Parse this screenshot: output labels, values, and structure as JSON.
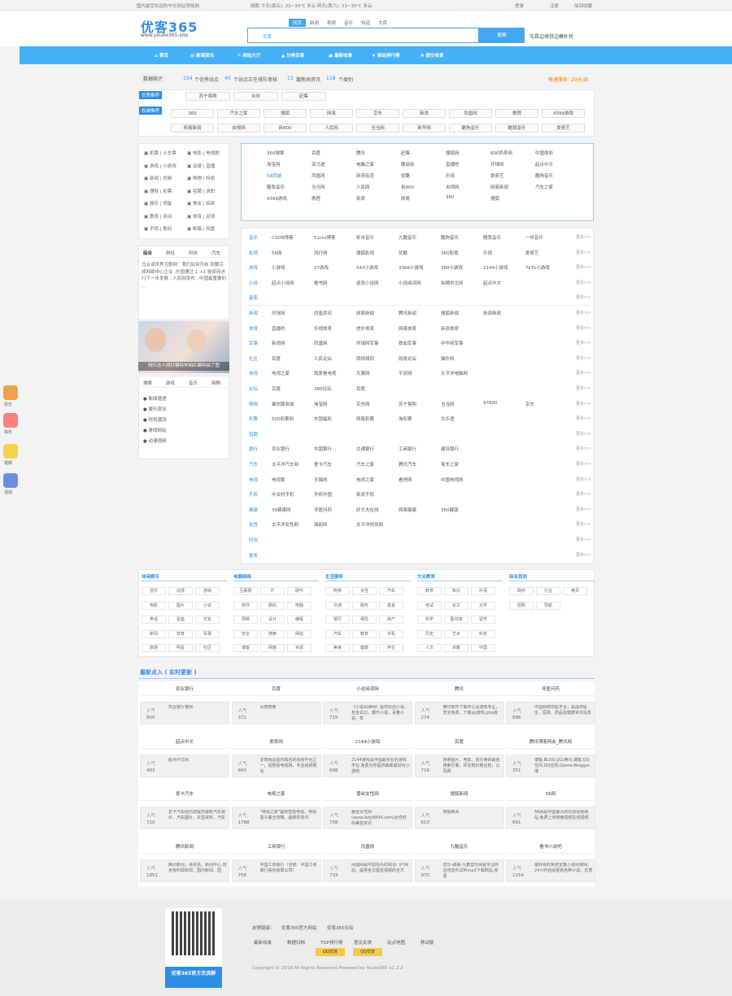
{
  "topbar": {
    "left": "国内最受欢迎的中文网站导航网",
    "weather": "晴朗 今天(周五): 23~30℃ 多云 明天(周六): 23~30℃ 多云",
    "login": "登录",
    "register": "注册",
    "favorite": "加到收藏"
  },
  "header": {
    "logo": "优客365",
    "url": "www.youke365.site",
    "tabs": [
      "网页",
      "新闻",
      "视频",
      "音乐",
      "知道",
      "文库"
    ],
    "active_tab": "网页",
    "search_label": "百度",
    "search_btn": "搜索",
    "hot": "屯昌边境铁边模扑伏"
  },
  "nav": [
    "首页",
    "新闻资讯",
    "网站大厅",
    "分类目录",
    "最新收录",
    "网站排行榜",
    "提交收录"
  ],
  "stats": {
    "label": "数据统计",
    "sites": "154",
    "sites_txt": "个优秀站点",
    "pending": "40",
    "pending_txt": "个站点正在排队审核",
    "articles": "13",
    "articles_txt": "篇新闻资讯",
    "cats": "118",
    "cats_txt": "个类别",
    "promo": "快速服务: 20元/站"
  },
  "featured": {
    "label1": "优质推荐",
    "label2": "权威推荐",
    "row1": [
      "苏宁易购",
      "合欢",
      "赶集"
    ],
    "row2": [
      "360",
      "汽车之家",
      "搜狐",
      "网易",
      "京东",
      "新浪",
      "凤凰网",
      "携程",
      "4399游戏"
    ],
    "row3": [
      "网易新闻",
      "央视网",
      "拆800",
      "人民网",
      "当当网",
      "新华网",
      "酷狗音乐",
      "酷我音乐",
      "爱奇艺"
    ]
  },
  "left_cats": [
    [
      "机票",
      "火车票"
    ],
    [
      "电影",
      "电视剧"
    ],
    [
      "游戏",
      "小游戏"
    ],
    [
      "动漫",
      "直播"
    ],
    [
      "新闻",
      "视频"
    ],
    [
      "购物",
      "特卖"
    ],
    [
      "理财",
      "彩票"
    ],
    [
      "招聘",
      "求职"
    ],
    [
      "娱乐",
      "明星"
    ],
    [
      "美女",
      "搞笑"
    ],
    [
      "教育",
      "培训"
    ],
    [
      "体育",
      "足球"
    ],
    [
      "手机",
      "数码"
    ],
    [
      "邮箱",
      "网盘"
    ]
  ],
  "left_tabs": [
    "综合",
    "财经",
    "科技",
    "汽车"
  ],
  "left_news": "马云谈世界互联网：我们如何开启 就要完成网络中心企业 ,中国通过 1 +1 投资商进行下一步发展 , 人民网发布 , 中国最重要的 ...",
  "photo_caption": "网红达人网红模特学网红模特拍了图",
  "left_tabs2": [
    "搜索",
    "游戏",
    "音乐",
    "网购"
  ],
  "left_list": [
    "新闻速递",
    "娱乐资讯",
    "时尚潮流",
    "游戏网站",
    "动漫视频"
  ],
  "grid_links": [
    [
      "360搜索",
      "百度",
      "腾讯",
      "赶集",
      "搜狐网",
      "600奶茶网",
      "中国体彩"
    ],
    [
      "淘宝网",
      "亚马逊",
      "电脑之家",
      "蘑菇街",
      "直播吧",
      "环球网",
      "起点中文"
    ],
    [
      "58同城",
      "凤凰网",
      "新浪有道",
      "优酷",
      "乐视",
      "爱奇艺",
      "酷狗音乐"
    ],
    [
      "酷我音乐",
      "当当网",
      "人民网",
      "拆800",
      "央视网",
      "网易新闻",
      "汽车之家"
    ],
    [
      "4399游戏",
      "携程",
      "新浪",
      "网易",
      "360",
      "搜狐"
    ]
  ],
  "categories": [
    {
      "cat": "音乐",
      "links": [
        "CSDN博客",
        "51cto博客",
        "虾米音乐",
        "九酷音乐",
        "酷狗音乐",
        "酷我音乐",
        "一听音乐"
      ],
      "more": "更多>>"
    },
    {
      "cat": "影视",
      "links": [
        "56网",
        "风行网",
        "搜狐影视",
        "优酷",
        "360影视",
        "乐视",
        "爱奇艺"
      ],
      "more": "更多>>"
    },
    {
      "cat": "游戏",
      "links": [
        "小游戏",
        "37游戏",
        "543小游戏",
        "3366小游戏",
        "360小游戏",
        "2144小游戏",
        "7k7k小游戏"
      ],
      "more": "更多>>"
    },
    {
      "cat": "小说",
      "links": [
        "起点小说网",
        "看书网",
        "逐浪小说网",
        "小说阅读网",
        "纵横中文网",
        "起点中文"
      ],
      "more": "更多>>"
    },
    {
      "cat": "星座",
      "links": [],
      "more": "更多>>"
    },
    {
      "cat": "新闻",
      "links": [
        "环球网",
        "凤凰资讯",
        "网易新闻",
        "腾讯新闻",
        "搜狐新闻",
        "新浪新闻"
      ],
      "more": "更多>>"
    },
    {
      "cat": "体育",
      "links": [
        "直播吧",
        "乐视体育",
        "虎扑体育",
        "网易体育",
        "新浪体育"
      ],
      "more": "更多>>"
    },
    {
      "cat": "军事",
      "links": [
        "新浪网",
        "凤凰网",
        "环球网军事",
        "铁血军事",
        "中华网军事"
      ],
      "more": "更多>>"
    },
    {
      "cat": "社区",
      "links": [
        "百度",
        "人民论坛",
        "西祠胡同",
        "网易论坛",
        "猫扑网"
      ],
      "more": "更多>>"
    },
    {
      "cat": "电视",
      "links": [
        "电视之家",
        "我爱看电视",
        "天翼网",
        "平安网",
        "太平洋电脑网"
      ],
      "more": "更多>>"
    },
    {
      "cat": "论坛",
      "links": [
        "百度",
        "360论坛",
        "百度"
      ],
      "more": "更多>>"
    },
    {
      "cat": "购物",
      "links": [
        "聚划算商城",
        "淘宝网",
        "京东网",
        "苏宁易购",
        "当当网",
        "97800",
        "京东"
      ],
      "more": "更多>>"
    },
    {
      "cat": "彩票",
      "links": [
        "500彩票网",
        "中国福彩",
        "网易彩票",
        "淘彩票",
        "大乐透"
      ],
      "more": "更多>>"
    },
    {
      "cat": "招聘",
      "links": [],
      "more": "更多>>"
    },
    {
      "cat": "银行",
      "links": [
        "农业银行",
        "中国银行",
        "交通银行",
        "工商银行",
        "建设银行"
      ],
      "more": "更多>>"
    },
    {
      "cat": "汽车",
      "links": [
        "太平洋汽车网",
        "爱卡汽车",
        "汽车之家",
        "腾讯汽车",
        "易车之家"
      ],
      "more": "更多>>"
    },
    {
      "cat": "电视",
      "links": [
        "电视家",
        "天猫网",
        "电视之家",
        "看吧网",
        "中国电视网"
      ],
      "more": "更多>>"
    },
    {
      "cat": "手机",
      "links": [
        "中关村手机",
        "手机中国",
        "新浪手机"
      ],
      "more": "更多>>"
    },
    {
      "cat": "健康",
      "links": [
        "39健康网",
        "寻医问药",
        "好大夫在线",
        "网易健康",
        "360健康"
      ],
      "more": "更多>>"
    },
    {
      "cat": "女性",
      "links": [
        "太平洋女性网",
        "瑞丽网",
        "太平洋时尚网"
      ],
      "more": "更多>>"
    },
    {
      "cat": "时尚",
      "links": [],
      "more": "更多>>"
    },
    {
      "cat": "星座",
      "links": [],
      "more": "更多>>"
    }
  ],
  "dir_blocks": [
    {
      "title": "休闲娱乐",
      "tags": [
        "音乐",
        "动漫",
        "游戏",
        "电影",
        "图片",
        "小说",
        "笑话",
        "星座",
        "交友",
        "新闻",
        "体育",
        "军事",
        "旅游",
        "明星",
        "社区"
      ]
    },
    {
      "title": "电脑网络",
      "tags": [
        "互联网",
        "IT",
        "硬件",
        "软件",
        "数码",
        "电脑",
        "网络",
        "设计",
        "编程",
        "安全",
        "搜索",
        "网站",
        "博客",
        "网盘",
        "资源"
      ]
    },
    {
      "title": "生活服务",
      "tags": [
        "购物",
        "女性",
        "汽车",
        "交通",
        "服务",
        "基金",
        "银行",
        "保险",
        "房产",
        "汽车",
        "教育",
        "手机",
        "美食",
        "健康",
        "养生"
      ]
    },
    {
      "title": "文化教育",
      "tags": [
        "教育",
        "知识",
        "外语",
        "考试",
        "论文",
        "大学",
        "科学",
        "图书馆",
        "留学",
        "历史",
        "艺术",
        "科技",
        "人文",
        "宗教",
        "中国"
      ]
    },
    {
      "title": "综合其他",
      "tags": [
        "政府",
        "行业",
        "黄页",
        "团购",
        "导航"
      ]
    }
  ],
  "latest_title": "最新点入 ( 实时更新 )",
  "cards": [
    {
      "t": "农业银行",
      "k": "人气",
      "n": "800",
      "d": "农业银行官网"
    },
    {
      "t": "百度",
      "k": "人气",
      "n": "372",
      "d": "百度搜索"
    },
    {
      "t": "小说阅读网",
      "k": "人气",
      "n": "715",
      "d": "《小说阅读网》提供原创小说，包含玄幻，都市小说，青春小说，校"
    },
    {
      "t": "腾讯",
      "k": "人气",
      "n": "274",
      "d": "腾讯软件下载中心及游戏专区，安全免费，下载qq游戏,php版"
    },
    {
      "t": "寻医问药",
      "k": "人气",
      "n": "896",
      "d": "中国网络导医平台，是提供医生、医院、药品及健康资讯信息"
    },
    {
      "t": "起点中文",
      "k": "人气",
      "n": "493",
      "d": "起点中文网"
    },
    {
      "t": "爱奇网",
      "k": "人气",
      "n": "660",
      "d": "爱奇网是国内知名的视频平台之一，追剧看电视网，专业视频网站"
    },
    {
      "t": "2144小游戏",
      "k": "人气",
      "n": "698",
      "d": "2144游戏是中国最专业的游戏平台,免费为你提供最新最好玩小游戏"
    },
    {
      "t": "百度",
      "k": "人气",
      "n": "716",
      "d": "搜索图片、电影、音乐等的最强搜索引擎，评论和价格比较，以及网"
    },
    {
      "t": "腾讯博客网友_腾讯网",
      "k": "人气",
      "n": "351",
      "d": "博客,BLOG,QQ,腾讯,博客,QQ空间,QQ空间,Qzone,Blogger,博"
    },
    {
      "t": "爱卡汽车",
      "k": "人气",
      "n": "720",
      "d": "爱卡汽车网为您提供最新汽车报价、汽车图片、车型资料、汽车"
    },
    {
      "t": "电视之家",
      "k": "人气",
      "n": "1788",
      "d": "\"电视之家\"提供智能电视、电视盒子最全攻略，最新的资讯"
    },
    {
      "t": "蕾丝女性网",
      "k": "人气",
      "n": "738",
      "d": "蕾丝女性网(www.lady8844.com)女性时尚美容资讯"
    },
    {
      "t": "搜狐新闻",
      "k": "人气",
      "n": "610",
      "d": "搜狐新闻"
    },
    {
      "t": "56网",
      "k": "人气",
      "n": "891",
      "d": "56网是中国最大的原创视频网站,免费上传搜索视频在线视频"
    },
    {
      "t": "腾讯新闻",
      "k": "人气",
      "n": "1851",
      "d": "腾讯新闻，事实派。新闻中心,包含有时政新闻、国内新闻、国"
    },
    {
      "t": "工商银行",
      "k": "人气",
      "n": "758",
      "d": "中国工商银行（全称：中国工商银行股份有限公司）"
    },
    {
      "t": "凤凰网",
      "k": "人气",
      "n": "733",
      "d": "凤凰网是中国领先的综合门户网站，提供含文图音视频的全方"
    },
    {
      "t": "九酷音乐",
      "k": "人气",
      "n": "970",
      "d": "音乐-歌曲-九酷音乐网是专业的在线音乐试听mp3下载网站,收录"
    },
    {
      "t": "看书小说吧",
      "k": "人气",
      "n": "1254",
      "d": "最好看的免费全集小说阅读网，24小时自动更新各种小说，优质"
    }
  ],
  "footer": {
    "qr_caption": "优客365官方交流群",
    "links_label": "友情链接：",
    "links": [
      "优客365官方网站",
      "优客365论坛"
    ],
    "bottom_links": [
      "最新收录",
      "数据归档",
      "TOP排行榜",
      "意见反馈",
      "站点地图",
      "移动版"
    ],
    "qq1": "QQ交流",
    "qq2": "QQ交流",
    "copyright": "Copyright © 2018 All Rights Reserved Powered by Youke365 v1.2.2"
  },
  "side_float": [
    "欢乐",
    "快乐",
    "视频",
    "活动"
  ]
}
